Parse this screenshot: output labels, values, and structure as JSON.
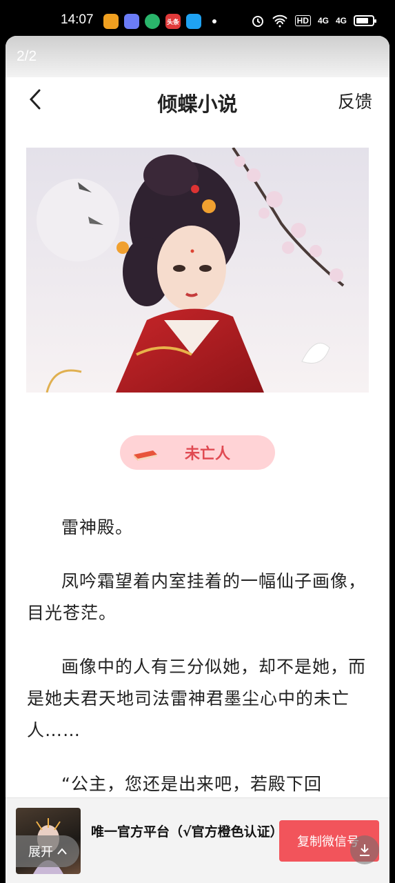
{
  "status_bar": {
    "time": "14:07",
    "notification_icons": [
      {
        "name": "app-icon-1",
        "color": "#f0a020"
      },
      {
        "name": "app-icon-2",
        "color": "#6b7cf6"
      },
      {
        "name": "app-icon-3",
        "color": "#2ab56b"
      },
      {
        "name": "toutiao-icon",
        "color": "#e03a3a",
        "label": "头条"
      },
      {
        "name": "app-icon-5",
        "color": "#1fa2f2"
      }
    ],
    "hd_label": "HD",
    "signal_1": "4G",
    "signal_2": "4G",
    "battery_level": 0.75
  },
  "page_indicator": "2/2",
  "nav": {
    "title": "倾蝶小说",
    "feedback_label": "反馈"
  },
  "chapter": {
    "title": "未亡人"
  },
  "article": {
    "paragraphs": [
      "雷神殿。",
      "凤吟霜望着内室挂着的一幅仙子画像，目光苍茫。",
      "画像中的人有三分似她，却不是她，而是她夫君天地司法雷神君墨尘心中的未亡人……",
      "“公主，您还是出来吧，若殿下回"
    ]
  },
  "banner": {
    "text": "唯一官方平台（√官方橙色认证）",
    "expand_label": "展开",
    "copy_label": "复制微信号"
  },
  "colors": {
    "accent": "#f2545b",
    "chapter_pill": "#ffd3d6",
    "chapter_text": "#e04a52"
  }
}
